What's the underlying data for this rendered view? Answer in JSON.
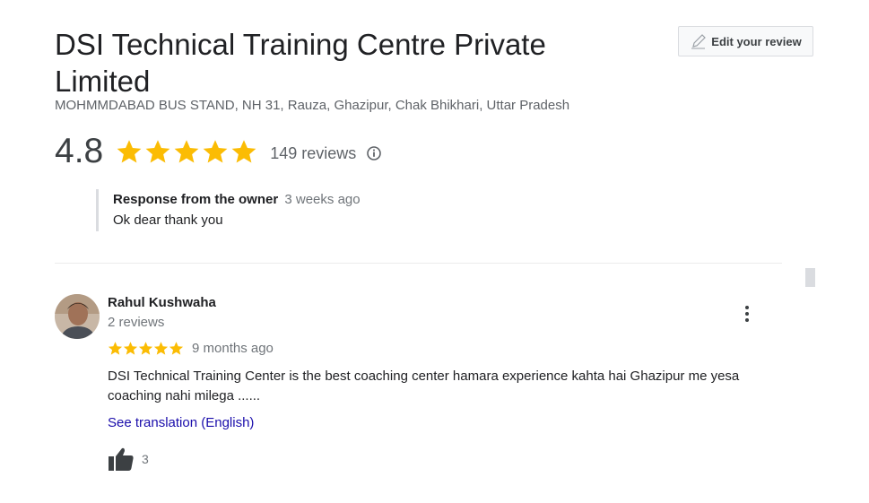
{
  "place": {
    "title": "DSI Technical Training Centre Private Limited",
    "address": "MOHMMDABAD BUS STAND, NH 31, Rauza, Ghazipur, Chak Bhikhari, Uttar Pradesh",
    "rating": "4.8",
    "stars": 5,
    "reviews_count": "149 reviews"
  },
  "edit_review": {
    "label": "Edit your review"
  },
  "owner_response": {
    "label": "Response from the owner",
    "time": "3 weeks ago",
    "text": "Ok dear thank you"
  },
  "review": {
    "reviewer_name": "Rahul Kushwaha",
    "reviewer_meta": "2 reviews",
    "stars": 5,
    "time": "9 months ago",
    "text": "DSI Technical Training Center is the best coaching center hamara experience kahta hai Ghazipur me yesa coaching nahi milega ......",
    "translate_link": "See translation (English)",
    "likes": "3"
  },
  "colors": {
    "star": "#fbbc04",
    "link": "#1a0dab",
    "muted": "#70757a"
  },
  "icons": [
    "pencil-icon",
    "star-icon",
    "info-icon",
    "more-vert-icon",
    "thumbs-up-icon"
  ]
}
